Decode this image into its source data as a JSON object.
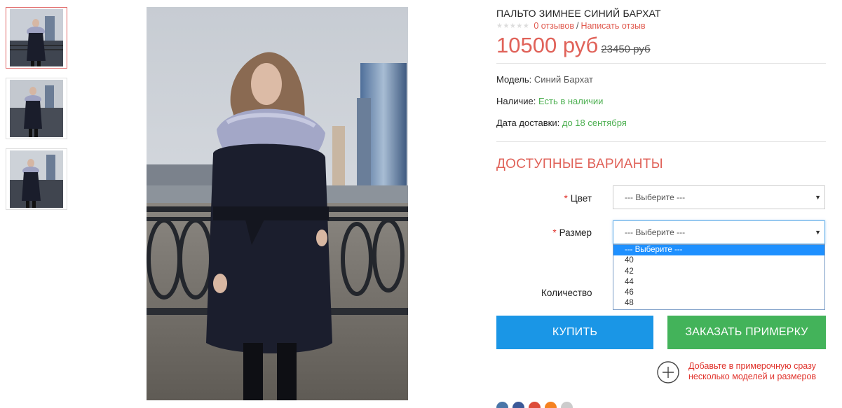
{
  "product": {
    "title": "ПАЛЬТО ЗИМНЕЕ СИНИЙ БАРХАТ",
    "rating_stars": "★★★★★",
    "reviews_link": "0 отзывов",
    "reviews_sep": "/",
    "write_review_link": "Написать отзыв",
    "price_new": "10500 руб",
    "price_old": "23450 руб"
  },
  "meta": {
    "model_label": "Модель:",
    "model_value": "Синий Бархат",
    "stock_label": "Наличие:",
    "stock_value": "Есть в наличии",
    "delivery_label": "Дата доставки:",
    "delivery_value": "до 18 сентября"
  },
  "variants": {
    "title": "ДОСТУПНЫЕ ВАРИАНТЫ",
    "required_mark": "*",
    "color_label": "Цвет",
    "color_selected": "--- Выберите ---",
    "size_label": "Размер",
    "size_selected": "--- Выберите ---",
    "size_options": [
      "--- Выберите ---",
      "40",
      "42",
      "44",
      "46",
      "48"
    ],
    "quantity_label": "Количество"
  },
  "actions": {
    "buy_label": "КУПИТЬ",
    "fitting_label": "ЗАКАЗАТЬ ПРИМЕРКУ",
    "fitting_note": "Добавьте в примерочную сразу несколько моделей и размеров"
  },
  "colors": {
    "accent_red": "#e06259",
    "buy_blue": "#1a96e6",
    "fit_green": "#43b35a",
    "stock_green": "#4caf50"
  }
}
